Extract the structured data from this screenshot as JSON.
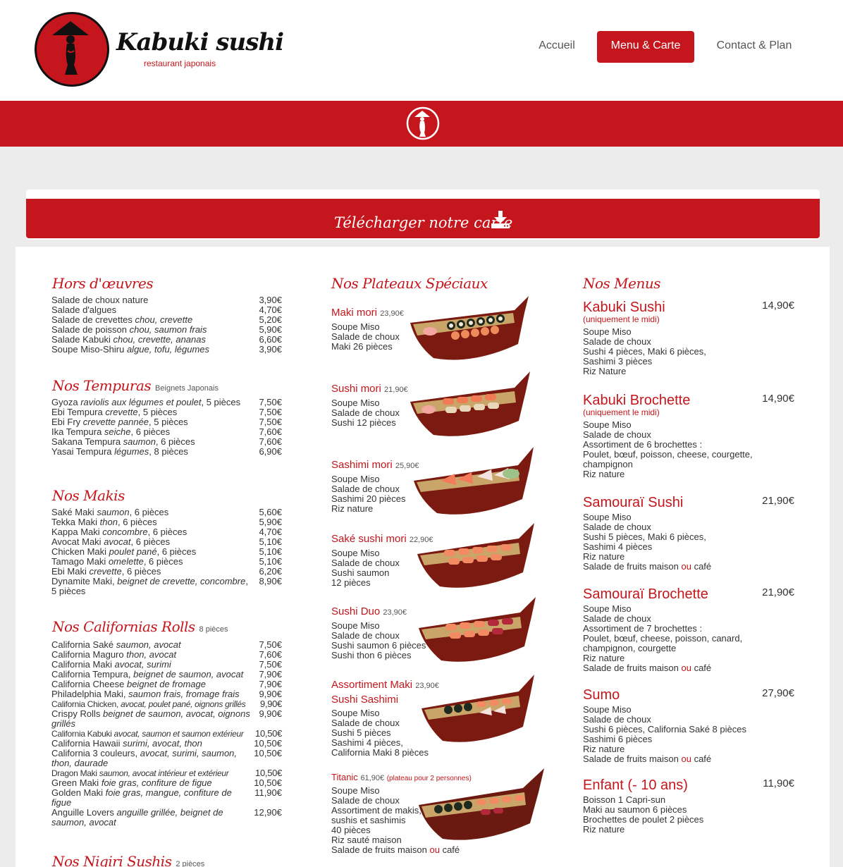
{
  "header": {
    "logo_name": "Kabuki sushi",
    "logo_sub": "restaurant japonais",
    "nav": [
      {
        "label": "Accueil"
      },
      {
        "label": "Menu & Carte"
      },
      {
        "label": "Contact & Plan"
      }
    ]
  },
  "download": {
    "label": "Télécharger notre carte"
  },
  "hors_oeuvres": {
    "title": "Hors d'œuvres",
    "items": [
      {
        "name": "Salade de choux nature",
        "desc": "",
        "price": "3,90€"
      },
      {
        "name": "Salade d'algues",
        "desc": "",
        "price": "4,70€"
      },
      {
        "name": "Salade de crevettes",
        "desc": "chou, crevette",
        "price": "5,20€"
      },
      {
        "name": "Salade de poisson",
        "desc": "chou, saumon frais",
        "price": "5,90€"
      },
      {
        "name": "Salade Kabuki",
        "desc": "chou, crevette, ananas",
        "price": "6,60€"
      },
      {
        "name": "Soupe Miso-Shiru",
        "desc": "algue, tofu, légumes",
        "price": "3,90€"
      }
    ]
  },
  "tempuras": {
    "title": "Nos Tempuras",
    "note": "Beignets Japonais",
    "items": [
      {
        "name": "Gyoza",
        "desc": "raviolis aux légumes et poulet",
        "extra": ", 5 pièces",
        "price": "7,50€"
      },
      {
        "name": "Ebi Tempura",
        "desc": "crevette",
        "extra": ", 5 pièces",
        "price": "7,50€"
      },
      {
        "name": "Ebi Fry",
        "desc": "crevette pannée",
        "extra": ", 5 pièces",
        "price": "7,50€"
      },
      {
        "name": "Ika Tempura",
        "desc": "seiche",
        "extra": ", 6 pièces",
        "price": "7,60€"
      },
      {
        "name": "Sakana Tempura",
        "desc": "saumon",
        "extra": ", 6 pièces",
        "price": "7,60€"
      },
      {
        "name": "Yasai Tempura",
        "desc": "légumes",
        "extra": ", 8 pièces",
        "price": "6,90€"
      }
    ]
  },
  "makis": {
    "title": "Nos Makis",
    "items": [
      {
        "name": "Saké Maki",
        "desc": "saumon",
        "extra": ", 6 pièces",
        "price": "5,60€"
      },
      {
        "name": "Tekka Maki",
        "desc": "thon",
        "extra": ", 6 pièces",
        "price": "5,90€"
      },
      {
        "name": "Kappa Maki",
        "desc": "concombre",
        "extra": ", 6 pièces",
        "price": "4,70€"
      },
      {
        "name": "Avocat Maki",
        "desc": "avocat",
        "extra": ", 6 pièces",
        "price": "5,10€"
      },
      {
        "name": "Chicken Maki",
        "desc": "poulet pané",
        "extra": ", 6 pièces",
        "price": "5,10€"
      },
      {
        "name": "Tamago Maki",
        "desc": "omelette",
        "extra": ", 6 pièces",
        "price": "5,10€"
      },
      {
        "name": "Ebi Maki",
        "desc": "crevette",
        "extra": ", 6 pièces",
        "price": "6,20€"
      },
      {
        "name": "Dynamite Maki,",
        "desc": "beignet de crevette, concombre",
        "extra": ", 5 pièces",
        "price": "8,90€"
      }
    ]
  },
  "californias": {
    "title": "Nos Californias Rolls",
    "note": "8 pièces",
    "items": [
      {
        "name": "California Saké",
        "desc": "saumon, avocat",
        "price": "7,50€"
      },
      {
        "name": "California Maguro",
        "desc": "thon, avocat",
        "price": "7,60€"
      },
      {
        "name": "California Maki",
        "desc": "avocat, surimi",
        "price": "7,50€"
      },
      {
        "name": "California Tempura,",
        "desc": "beignet de saumon, avocat",
        "price": "7,90€"
      },
      {
        "name": "California Cheese",
        "desc": "beignet de fromage",
        "price": "7,90€"
      },
      {
        "name": "Philadelphia Maki,",
        "desc": "saumon frais, fromage frais",
        "price": "9,90€"
      },
      {
        "name": "California Chicken,",
        "desc": "avocat, poulet pané, oignons grillés",
        "price": "9,90€"
      },
      {
        "name": "Crispy Rolls",
        "desc": "beignet de saumon, avocat, oignons grillés",
        "price": "9,90€"
      },
      {
        "name": "California Kabuki",
        "desc": "avocat, saumon et saumon extérieur",
        "price": "10,50€"
      },
      {
        "name": "California Hawaii",
        "desc": "surimi, avocat, thon",
        "price": "10,50€"
      },
      {
        "name": "California 3 couleurs,",
        "desc": "avocat, surimi, saumon, thon, daurade",
        "price": "10,50€"
      },
      {
        "name": "Dragon Maki",
        "desc": "saumon, avocat intérieur et extérieur",
        "price": "10,50€"
      },
      {
        "name": "Green Maki",
        "desc": "foie gras, confiture de figue",
        "price": "10,50€"
      },
      {
        "name": "Golden Maki",
        "desc": "foie gras, mangue, confiture de figue",
        "price": "11,90€"
      },
      {
        "name": "Anguille Lovers",
        "desc": "anguille grillée, beignet de saumon, avocat",
        "price": "12,90€"
      }
    ]
  },
  "nigiri": {
    "title": "Nos Nigiri Sushis",
    "note": "2 pièces"
  },
  "plateaux": {
    "title": "Nos Plateaux Spéciaux",
    "items": [
      {
        "name": "Maki mori",
        "price": "23,90€",
        "note": "",
        "lines": [
          "Soupe Miso",
          "Salade de choux",
          "Maki 26 pièces"
        ]
      },
      {
        "name": "Sushi mori",
        "price": "21,90€",
        "note": "",
        "lines": [
          "Soupe Miso",
          "Salade de choux",
          "Sushi 12 pièces"
        ]
      },
      {
        "name": "Sashimi mori",
        "price": "25,90€",
        "note": "",
        "lines": [
          "Soupe Miso",
          "Salade de choux",
          "Sashimi 20 pièces",
          "Riz nature"
        ]
      },
      {
        "name": "Saké sushi mori",
        "price": "22,90€",
        "note": "",
        "lines": [
          "Soupe Miso",
          "Salade de choux",
          "Sushi saumon",
          "12 pièces"
        ]
      },
      {
        "name": "Sushi Duo",
        "price": "23,90€",
        "note": "",
        "lines": [
          "Soupe Miso",
          "Salade de choux",
          "Sushi saumon 6 pièces",
          "Sushi thon 6 pièces"
        ]
      },
      {
        "name": "Assortiment Maki",
        "name2": "Sushi Sashimi",
        "price": "23,90€",
        "note": "",
        "lines": [
          "Soupe Miso",
          "Salade de choux",
          "Sushi 5 pièces",
          "Sashimi 4 pièces,",
          "California Maki 8 pièces"
        ]
      },
      {
        "name": "Titanic",
        "price": "61,90€",
        "note": "(plateau pour 2 personnes)",
        "lines": [
          "Soupe Miso",
          "Salade de choux",
          "Assortiment de makis,",
          "sushis et sashimis",
          "40 pièces",
          "Riz sauté maison"
        ],
        "last": {
          "a": "Salade de fruits maison",
          "ou": "ou",
          "b": "café"
        }
      }
    ]
  },
  "menus": {
    "title": "Nos Menus",
    "items": [
      {
        "name": "Kabuki Sushi",
        "price": "14,90€",
        "note": "(uniquement le midi)",
        "lines": [
          "Soupe Miso",
          "Salade de choux",
          "Sushi 4 pièces, Maki 6 pièces,",
          "Sashimi 3 pièces",
          "Riz Nature"
        ]
      },
      {
        "name": "Kabuki Brochette",
        "price": "14,90€",
        "note": "(uniquement le midi)",
        "lines": [
          "Soupe Miso",
          "Salade de choux",
          "Assortiment de 6 brochettes :",
          "Poulet, bœuf, poisson, cheese, courgette,",
          "champignon",
          "Riz nature"
        ]
      },
      {
        "name": "Samouraï Sushi",
        "price": "21,90€",
        "note": "",
        "lines": [
          "Soupe Miso",
          "Salade de choux",
          "Sushi 5 pièces, Maki 6 pièces,",
          "Sashimi 4 pièces",
          "Riz nature"
        ],
        "last": {
          "a": "Salade de fruits maison",
          "ou": "ou",
          "b": "café"
        }
      },
      {
        "name": "Samouraï Brochette",
        "price": "21,90€",
        "note": "",
        "lines": [
          "Soupe Miso",
          "Salade de choux",
          "Assortiment de 7 brochettes :",
          "Poulet, bœuf, cheese, poisson, canard,",
          "champignon, courgette",
          "Riz nature"
        ],
        "last": {
          "a": "Salade de fruits maison",
          "ou": "ou",
          "b": "café"
        }
      },
      {
        "name": "Sumo",
        "price": "27,90€",
        "note": "",
        "lines": [
          "Soupe Miso",
          "Salade de choux",
          "Sushi 6 pièces, California Saké 8 pièces",
          "Sashimi 6 pièces",
          "Riz nature"
        ],
        "last": {
          "a": "Salade de fruits maison",
          "ou": "ou",
          "b": "café"
        }
      },
      {
        "name": "Enfant (- 10 ans)",
        "price": "11,90€",
        "note": "",
        "lines": [
          "Boisson 1 Capri-sun",
          "Maki au saumon 6 pièces",
          "Brochettes de poulet 2 pièces",
          "Riz nature"
        ]
      }
    ]
  }
}
